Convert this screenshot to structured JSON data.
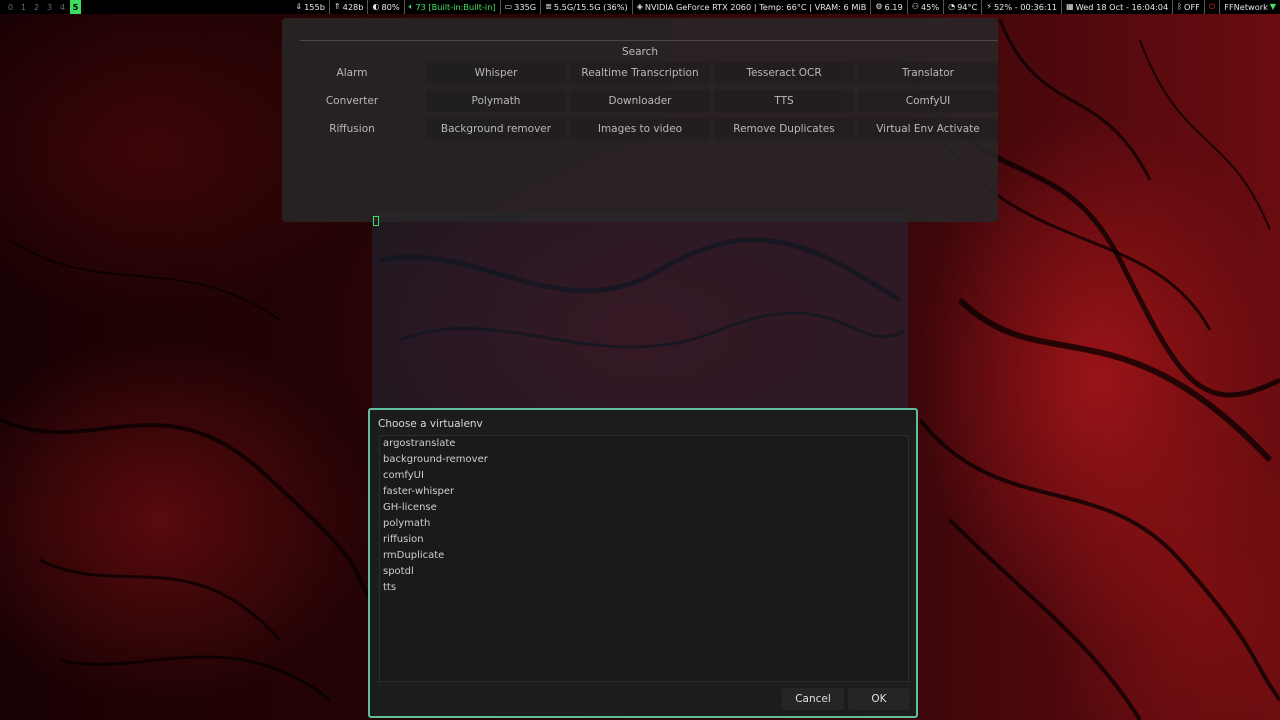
{
  "topbar": {
    "workspaces": [
      "0",
      "1",
      "2",
      "3",
      "4",
      "5"
    ],
    "active_workspace": "5",
    "net_down": "155b",
    "net_up": "428b",
    "brightness": "80%",
    "volume": "73 [Built-in:Built-in]",
    "disk": "335G",
    "memory": "5.5G/15.5G (36%)",
    "gpu": "NVIDIA GeForce RTX 2060 | Temp: 66°C | VRAM: 6 MiB",
    "load": "6.19",
    "cpu": "45%",
    "temp": "94°C",
    "battery": "52% - 00:36:11",
    "datetime": "Wed 18 Oct - 16:04:04",
    "bluetooth": "OFF",
    "network": "FFNetwork",
    "colors": {
      "accent": "#45e35f",
      "power": "#e02b2b"
    }
  },
  "launcher": {
    "title": "Search",
    "items": [
      "Alarm",
      "Whisper",
      "Realtime Transcription",
      "Tesseract OCR",
      "Translator",
      "Converter",
      "Polymath",
      "Downloader",
      "TTS",
      "ComfyUI",
      "Riffusion",
      "Background remover",
      "Images to video",
      "Remove Duplicates",
      "Virtual Env Activate"
    ]
  },
  "dialog": {
    "title": "Choose a virtualenv",
    "items": [
      "argostranslate",
      "background-remover",
      "comfyUI",
      "faster-whisper",
      "GH-license",
      "polymath",
      "riffusion",
      "rmDuplicate",
      "spotdl",
      "tts"
    ],
    "cancel_label": "Cancel",
    "ok_label": "OK",
    "border_color": "#5fbf9a"
  }
}
